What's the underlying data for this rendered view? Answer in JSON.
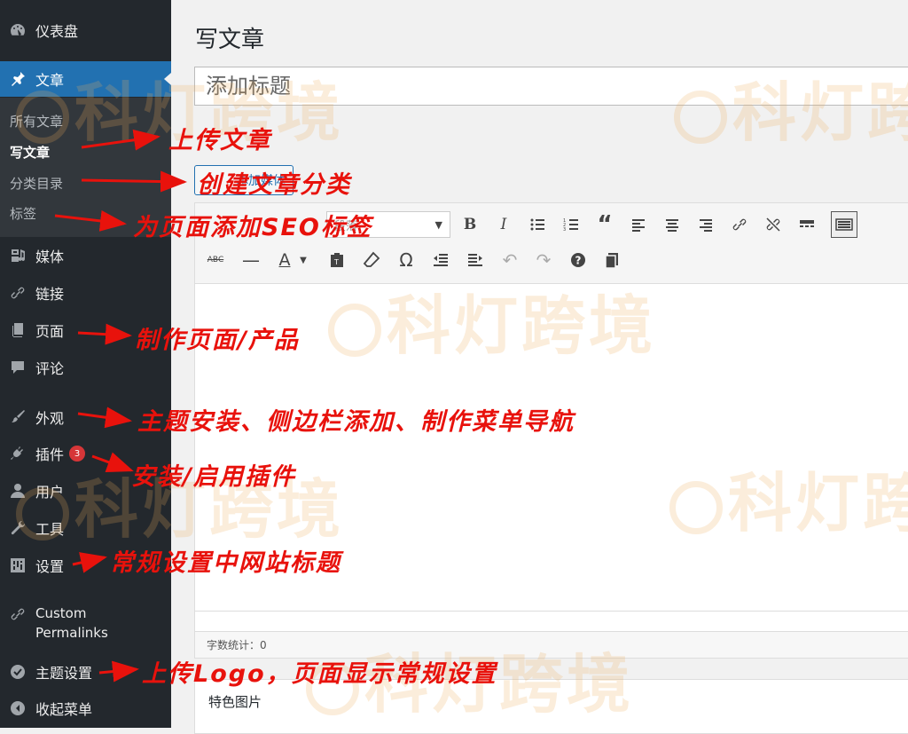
{
  "sidebar": {
    "dashboard": "仪表盘",
    "posts": "文章",
    "posts_sub": [
      "所有文章",
      "写文章",
      "分类目录",
      "标签"
    ],
    "media": "媒体",
    "links": "链接",
    "pages": "页面",
    "comments": "评论",
    "appearance": "外观",
    "plugins": "插件",
    "plugins_badge": "3",
    "users": "用户",
    "tools": "工具",
    "settings": "设置",
    "custom_permalinks_1": "Custom",
    "custom_permalinks_2": "Permalinks",
    "theme_settings": "主题设置",
    "collapse": "收起菜单"
  },
  "main": {
    "page_title": "写文章",
    "title_placeholder": "添加标题",
    "add_media": "添加媒体",
    "format_select": "段落",
    "word_count": "字数统计：0",
    "featured_image": "特色图片"
  },
  "watermark": "科灯跨境",
  "annotations": {
    "upload_post": "上传文章",
    "create_category": "创建文章分类",
    "seo_tags": "为页面添加SEO标签",
    "make_pages": "制作页面/产品",
    "theme_install": "主题安装、侧边栏添加、制作菜单导航",
    "plugins": "安装/启用插件",
    "site_title": "常规设置中网站标题",
    "logo": "上传Logo，页面显示常规设置"
  },
  "colors": {
    "sidebar_bg": "#23282d",
    "active_bg": "#2271b1",
    "annotation": "#e8120c",
    "watermark": "#ebaf5a"
  }
}
